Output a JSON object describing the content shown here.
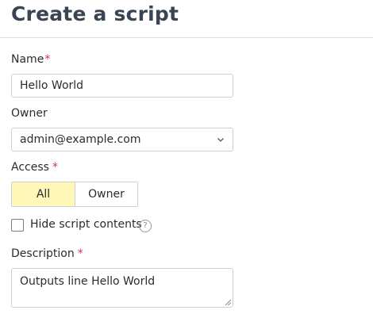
{
  "page": {
    "title": "Create a script"
  },
  "form": {
    "name": {
      "label": "Name",
      "required_mark": "*",
      "value": "Hello World"
    },
    "owner": {
      "label": "Owner",
      "value": "admin@example.com"
    },
    "access": {
      "label": "Access",
      "required_mark": "*",
      "options": [
        "All",
        "Owner"
      ],
      "selected": "All"
    },
    "hide_contents": {
      "label": "Hide script contents",
      "checked": false,
      "help_glyph": "?"
    },
    "description": {
      "label": "Description",
      "required_mark": "*",
      "value": "Outputs line Hello World"
    }
  },
  "colors": {
    "selected_segment": "#fff7b8",
    "required_mark": "#d6334a",
    "title": "#3a4452"
  },
  "icons": [
    "chevron-down-icon",
    "help-icon",
    "resize-grip-icon"
  ]
}
